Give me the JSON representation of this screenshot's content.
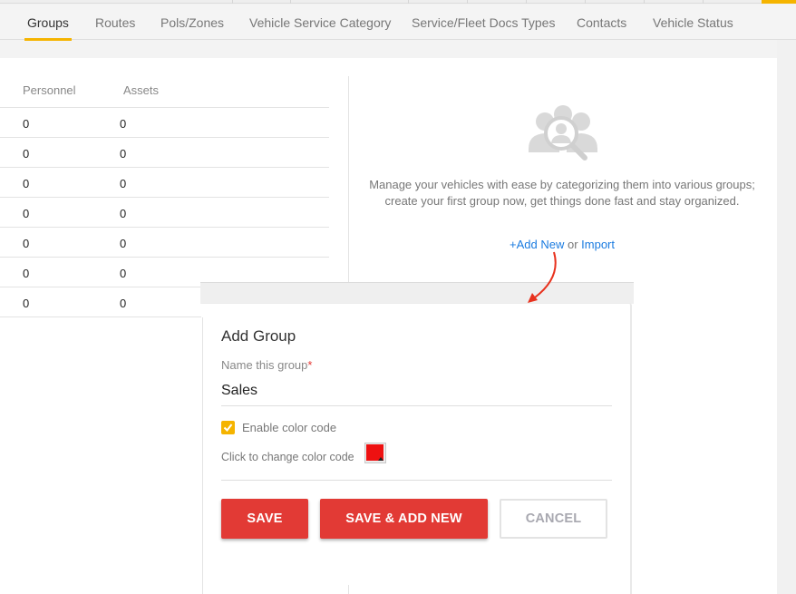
{
  "tabs": [
    {
      "label": "Groups",
      "active": true
    },
    {
      "label": "Routes",
      "active": false
    },
    {
      "label": "Pols/Zones",
      "active": false
    },
    {
      "label": "Vehicle Service Category",
      "active": false
    },
    {
      "label": "Service/Fleet Docs Types",
      "active": false
    },
    {
      "label": "Contacts",
      "active": false
    },
    {
      "label": "Vehicle Status",
      "active": false
    }
  ],
  "table": {
    "columns": [
      "Personnel",
      "Assets"
    ],
    "rows": [
      {
        "personnel": "0",
        "assets": "0"
      },
      {
        "personnel": "0",
        "assets": "0"
      },
      {
        "personnel": "0",
        "assets": "0"
      },
      {
        "personnel": "0",
        "assets": "0"
      },
      {
        "personnel": "0",
        "assets": "0"
      },
      {
        "personnel": "0",
        "assets": "0"
      },
      {
        "personnel": "0",
        "assets": "0"
      }
    ]
  },
  "empty_state": {
    "icon": "group-search-icon",
    "message": "Manage your vehicles with ease by categorizing them into various groups; create your first group now, get things done fast and stay organized.",
    "add_new_label": "+Add New",
    "or_label": "or",
    "import_label": "Import"
  },
  "modal": {
    "title": "Add Group",
    "name_label": "Name this group",
    "required_marker": "*",
    "name_value": "Sales",
    "enable_color_label": "Enable color code",
    "enable_color_checked": true,
    "color_label": "Click to change color code",
    "selected_color": "#ee1111",
    "save_label": "SAVE",
    "save_add_new_label": "SAVE & ADD NEW",
    "cancel_label": "CANCEL"
  },
  "colors": {
    "accent": "#f5b400",
    "primary_button": "#e23a35",
    "link": "#1a7be0",
    "annotation_arrow": "#e8321e"
  }
}
